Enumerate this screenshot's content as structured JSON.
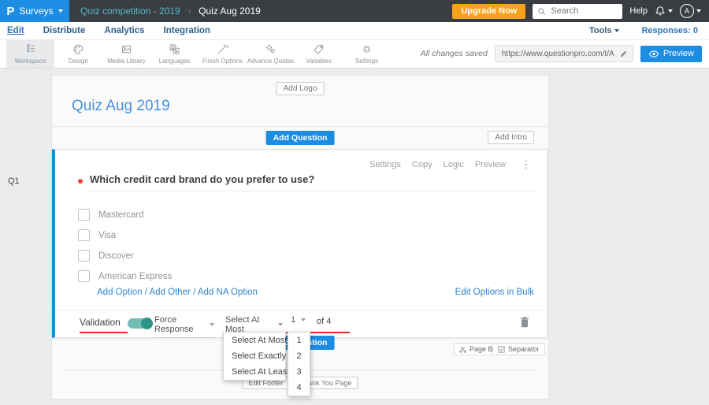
{
  "topbar": {
    "logo_letter": "P",
    "product": "Surveys",
    "breadcrumb": {
      "parent": "Quiz competition - 2019",
      "separator": "›",
      "current": "Quiz Aug 2019"
    },
    "upgrade_label": "Upgrade Now",
    "search_placeholder": "Search",
    "help_label": "Help",
    "avatar_initial": "A"
  },
  "nav": {
    "items": [
      {
        "label": "Edit"
      },
      {
        "label": "Distribute"
      },
      {
        "label": "Analytics"
      },
      {
        "label": "Integration"
      }
    ],
    "tools_label": "Tools",
    "responses_label": "Responses: 0"
  },
  "toolbar": {
    "items": [
      {
        "label": "Workspace"
      },
      {
        "label": "Design"
      },
      {
        "label": "Media Library"
      },
      {
        "label": "Languages"
      },
      {
        "label": "Finish Options"
      },
      {
        "label": "Advance Quotas"
      },
      {
        "label": "Variables"
      },
      {
        "label": "Settings"
      }
    ],
    "save_status": "All changes saved",
    "survey_url": "https://www.questionpro.com/t/APNrFZ",
    "preview_label": "Preview"
  },
  "survey": {
    "add_logo_label": "Add Logo",
    "title": "Quiz Aug 2019",
    "add_question_label": "Add Question",
    "add_intro_label": "Add Intro"
  },
  "question": {
    "number": "Q1",
    "actions": [
      {
        "label": "Settings"
      },
      {
        "label": "Copy"
      },
      {
        "label": "Logic"
      },
      {
        "label": "Preview"
      }
    ],
    "kebab": "⋮",
    "text": "Which credit card brand do you prefer to use?",
    "options": [
      {
        "label": "Mastercard"
      },
      {
        "label": "Visa"
      },
      {
        "label": "Discover"
      },
      {
        "label": "American Express"
      }
    ],
    "add_links": "Add Option / Add Other / Add NA Option",
    "bulk_edit_label": "Edit Options in Bulk"
  },
  "validation": {
    "label": "Validation",
    "force_response_label": "Force Response",
    "rule_value": "Select At Most",
    "count_value": "1",
    "of_label": "of 4"
  },
  "dropdowns": {
    "rule_options": [
      {
        "label": "Select At Most"
      },
      {
        "label": "Select Exactly"
      },
      {
        "label": "Select At Least"
      }
    ],
    "count_options": [
      {
        "label": "1"
      },
      {
        "label": "2"
      },
      {
        "label": "3"
      },
      {
        "label": "4"
      }
    ]
  },
  "page_footer": {
    "add_question_label": "Add Question",
    "page_break_label": "Page Break",
    "separator_label": "Separator",
    "edit_footer_label": "Edit Footer",
    "thank_you_label": "Thank You Page"
  },
  "colors": {
    "brand_blue": "#1d8ce3",
    "topbar_bg": "#3a3e42",
    "upgrade_orange": "#f7a11c",
    "toggle_teal": "#2a9488",
    "link_blue": "#2e86d1",
    "annotation_red": "#d93025",
    "title_blue": "#4a90d9",
    "breadcrumb_teal": "#54b7c9"
  }
}
